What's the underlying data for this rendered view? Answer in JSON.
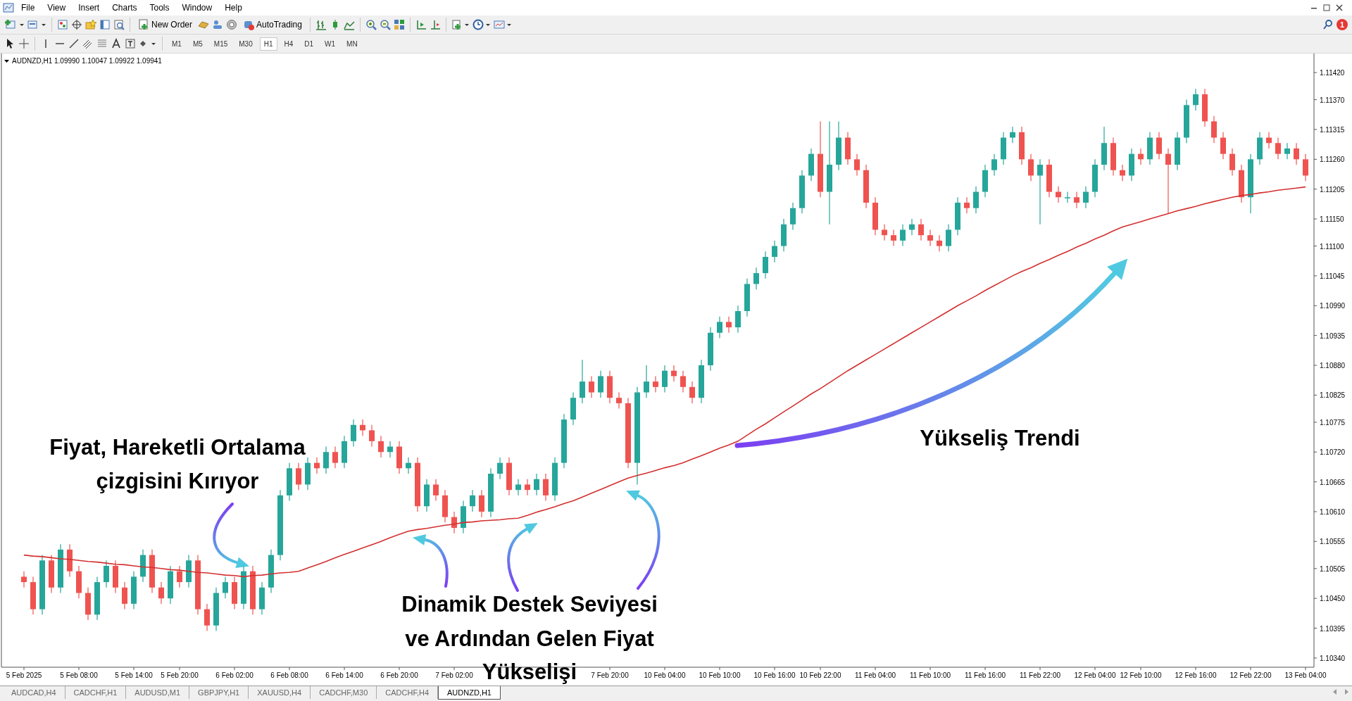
{
  "menu": [
    "File",
    "View",
    "Insert",
    "Charts",
    "Tools",
    "Window",
    "Help"
  ],
  "toolbar": {
    "buttons": [
      {
        "label": "New Order"
      },
      {
        "label": "AutoTrading"
      }
    ],
    "notification_count": "1"
  },
  "timeframes": [
    {
      "label": "M1",
      "selected": false
    },
    {
      "label": "M5",
      "selected": false
    },
    {
      "label": "M15",
      "selected": false
    },
    {
      "label": "M30",
      "selected": false
    },
    {
      "label": "H1",
      "selected": true
    },
    {
      "label": "H4",
      "selected": false
    },
    {
      "label": "D1",
      "selected": false
    },
    {
      "label": "W1",
      "selected": false
    },
    {
      "label": "MN",
      "selected": false
    }
  ],
  "chart": {
    "symbol_info": "AUDNZD,H1  1.09990 1.10047 1.09922 1.09941",
    "chart_data": {
      "type": "candlestick",
      "ylim": [
        1.10323,
        1.1145
      ],
      "yticks": [
        {
          "value": 1.1142,
          "label": "1.11420"
        },
        {
          "value": 1.1137,
          "label": "1.11370"
        },
        {
          "value": 1.11315,
          "label": "1.11315"
        },
        {
          "value": 1.1126,
          "label": "1.11260"
        },
        {
          "value": 1.11205,
          "label": "1.11205"
        },
        {
          "value": 1.1115,
          "label": "1.11150"
        },
        {
          "value": 1.111,
          "label": "1.11100"
        },
        {
          "value": 1.11045,
          "label": "1.11045"
        },
        {
          "value": 1.1099,
          "label": "1.10990"
        },
        {
          "value": 1.10935,
          "label": "1.10935"
        },
        {
          "value": 1.1088,
          "label": "1.10880"
        },
        {
          "value": 1.10825,
          "label": "1.10825"
        },
        {
          "value": 1.10775,
          "label": "1.10775"
        },
        {
          "value": 1.1072,
          "label": "1.10720"
        },
        {
          "value": 1.10665,
          "label": "1.10665"
        },
        {
          "value": 1.1061,
          "label": "1.10610"
        },
        {
          "value": 1.10555,
          "label": "1.10555"
        },
        {
          "value": 1.10505,
          "label": "1.10505"
        },
        {
          "value": 1.1045,
          "label": "1.10450"
        },
        {
          "value": 1.10395,
          "label": "1.10395"
        },
        {
          "value": 1.1034,
          "label": "1.10340"
        }
      ],
      "categories": [
        "5 Feb 2025",
        null,
        null,
        null,
        null,
        null,
        "5 Feb 08:00",
        null,
        null,
        null,
        null,
        null,
        "5 Feb 14:00",
        null,
        null,
        null,
        null,
        "5 Feb 20:00",
        null,
        null,
        null,
        null,
        null,
        "6 Feb 02:00",
        null,
        null,
        null,
        null,
        null,
        "6 Feb 08:00",
        null,
        null,
        null,
        null,
        null,
        "6 Feb 14:00",
        null,
        null,
        null,
        null,
        null,
        "6 Feb 20:00",
        null,
        null,
        null,
        null,
        null,
        "7 Feb 02:00",
        null,
        null,
        null,
        null,
        null,
        null,
        null,
        null,
        null,
        null,
        null,
        null,
        null,
        null,
        null,
        null,
        "7 Feb 20:00",
        null,
        null,
        null,
        null,
        null,
        "10 Feb 04:00",
        null,
        null,
        null,
        null,
        null,
        "10 Feb 10:00",
        null,
        null,
        null,
        null,
        null,
        "10 Feb 16:00",
        null,
        null,
        null,
        null,
        "10 Feb 22:00",
        null,
        null,
        null,
        null,
        null,
        "11 Feb 04:00",
        null,
        null,
        null,
        null,
        null,
        "11 Feb 10:00",
        null,
        null,
        null,
        null,
        null,
        "11 Feb 16:00",
        null,
        null,
        null,
        null,
        null,
        "11 Feb 22:00",
        null,
        null,
        null,
        null,
        null,
        "12 Feb 04:00",
        null,
        null,
        null,
        null,
        "12 Feb 10:00",
        null,
        null,
        null,
        null,
        null,
        "12 Feb 16:00",
        null,
        null,
        null,
        null,
        null,
        "12 Feb 22:00",
        null,
        null,
        null,
        null,
        null,
        "13 Feb 04:00"
      ],
      "ohlc": [
        [
          1.1049,
          1.105,
          1.1047,
          1.1048
        ],
        [
          1.1048,
          1.1049,
          1.1042,
          1.1043
        ],
        [
          1.1043,
          1.1053,
          1.1042,
          1.1052
        ],
        [
          1.1052,
          1.1053,
          1.1046,
          1.1047
        ],
        [
          1.1047,
          1.1055,
          1.1046,
          1.1054
        ],
        [
          1.1054,
          1.1055,
          1.1049,
          1.105
        ],
        [
          1.105,
          1.1051,
          1.1045,
          1.1046
        ],
        [
          1.1046,
          1.1047,
          1.1041,
          1.1042
        ],
        [
          1.1042,
          1.1049,
          1.1041,
          1.1048
        ],
        [
          1.1048,
          1.1052,
          1.1047,
          1.1051
        ],
        [
          1.1051,
          1.1052,
          1.1046,
          1.1047
        ],
        [
          1.1047,
          1.1048,
          1.1043,
          1.1044
        ],
        [
          1.1044,
          1.105,
          1.1043,
          1.1049
        ],
        [
          1.1049,
          1.1054,
          1.1048,
          1.1053
        ],
        [
          1.1053,
          1.1054,
          1.1046,
          1.1047
        ],
        [
          1.1047,
          1.1048,
          1.1044,
          1.1045
        ],
        [
          1.1045,
          1.1051,
          1.1044,
          1.105
        ],
        [
          1.105,
          1.1051,
          1.1047,
          1.1048
        ],
        [
          1.1048,
          1.1053,
          1.1047,
          1.1052
        ],
        [
          1.1052,
          1.1053,
          1.1042,
          1.1043
        ],
        [
          1.1043,
          1.1044,
          1.1039,
          1.104
        ],
        [
          1.104,
          1.1047,
          1.1039,
          1.1046
        ],
        [
          1.1046,
          1.1049,
          1.1045,
          1.1048
        ],
        [
          1.1048,
          1.1049,
          1.1043,
          1.1044
        ],
        [
          1.1044,
          1.1051,
          1.1043,
          1.105
        ],
        [
          1.105,
          1.1051,
          1.1042,
          1.1043
        ],
        [
          1.1043,
          1.1048,
          1.1042,
          1.1047
        ],
        [
          1.1047,
          1.1054,
          1.1046,
          1.1053
        ],
        [
          1.1053,
          1.1065,
          1.1052,
          1.1064
        ],
        [
          1.1064,
          1.107,
          1.1063,
          1.1069
        ],
        [
          1.1069,
          1.107,
          1.1065,
          1.1066
        ],
        [
          1.1066,
          1.1071,
          1.1065,
          1.107
        ],
        [
          1.107,
          1.1071,
          1.1068,
          1.1069
        ],
        [
          1.1069,
          1.1073,
          1.1068,
          1.1072
        ],
        [
          1.1072,
          1.1073,
          1.1069,
          1.107
        ],
        [
          1.107,
          1.1075,
          1.1069,
          1.1074
        ],
        [
          1.1074,
          1.1078,
          1.1073,
          1.1077
        ],
        [
          1.1077,
          1.1078,
          1.1075,
          1.1076
        ],
        [
          1.1076,
          1.1077,
          1.1073,
          1.1074
        ],
        [
          1.1074,
          1.1075,
          1.1071,
          1.1072
        ],
        [
          1.1072,
          1.1074,
          1.1071,
          1.1073
        ],
        [
          1.1073,
          1.1074,
          1.1068,
          1.1069
        ],
        [
          1.1069,
          1.1071,
          1.1068,
          1.107
        ],
        [
          1.107,
          1.1071,
          1.1061,
          1.1062
        ],
        [
          1.1062,
          1.1067,
          1.1061,
          1.1066
        ],
        [
          1.1066,
          1.1067,
          1.1063,
          1.1064
        ],
        [
          1.1064,
          1.1065,
          1.1059,
          1.106
        ],
        [
          1.106,
          1.1061,
          1.1057,
          1.1058
        ],
        [
          1.1058,
          1.1063,
          1.1057,
          1.1062
        ],
        [
          1.1062,
          1.1065,
          1.1061,
          1.1064
        ],
        [
          1.1064,
          1.1065,
          1.106,
          1.1061
        ],
        [
          1.1061,
          1.1069,
          1.106,
          1.1068
        ],
        [
          1.1068,
          1.1071,
          1.1067,
          1.107
        ],
        [
          1.107,
          1.1071,
          1.1064,
          1.1065
        ],
        [
          1.1065,
          1.1067,
          1.1064,
          1.1066
        ],
        [
          1.1066,
          1.1067,
          1.1064,
          1.1065
        ],
        [
          1.1065,
          1.1068,
          1.1064,
          1.1067
        ],
        [
          1.1067,
          1.1068,
          1.1063,
          1.1064
        ],
        [
          1.1064,
          1.1071,
          1.1063,
          1.107
        ],
        [
          1.107,
          1.1079,
          1.1069,
          1.1078
        ],
        [
          1.1078,
          1.1083,
          1.1077,
          1.1082
        ],
        [
          1.1082,
          1.1089,
          1.1081,
          1.1085
        ],
        [
          1.1085,
          1.1086,
          1.1082,
          1.1083
        ],
        [
          1.1083,
          1.1087,
          1.1082,
          1.1086
        ],
        [
          1.1086,
          1.1087,
          1.1081,
          1.1082
        ],
        [
          1.1082,
          1.1083,
          1.108,
          1.1081
        ],
        [
          1.1081,
          1.1082,
          1.1069,
          1.107
        ],
        [
          1.107,
          1.1084,
          1.1066,
          1.1083
        ],
        [
          1.1083,
          1.1088,
          1.1082,
          1.1085
        ],
        [
          1.1085,
          1.1086,
          1.1083,
          1.1084
        ],
        [
          1.1084,
          1.1088,
          1.1083,
          1.1087
        ],
        [
          1.1087,
          1.1088,
          1.1085,
          1.1086
        ],
        [
          1.1086,
          1.1087,
          1.1083,
          1.1084
        ],
        [
          1.1084,
          1.1085,
          1.1081,
          1.1082
        ],
        [
          1.1082,
          1.1089,
          1.1081,
          1.1088
        ],
        [
          1.1088,
          1.1095,
          1.1087,
          1.1094
        ],
        [
          1.1094,
          1.1097,
          1.1093,
          1.1096
        ],
        [
          1.1096,
          1.1097,
          1.1094,
          1.1095
        ],
        [
          1.1095,
          1.1099,
          1.1094,
          1.1098
        ],
        [
          1.1098,
          1.1104,
          1.1097,
          1.1103
        ],
        [
          1.1103,
          1.1106,
          1.1102,
          1.1105
        ],
        [
          1.1105,
          1.1109,
          1.1104,
          1.1108
        ],
        [
          1.1108,
          1.1111,
          1.1107,
          1.111
        ],
        [
          1.111,
          1.1115,
          1.1109,
          1.1114
        ],
        [
          1.1114,
          1.1118,
          1.1113,
          1.1117
        ],
        [
          1.1117,
          1.1124,
          1.1116,
          1.1123
        ],
        [
          1.1123,
          1.1128,
          1.1122,
          1.1127
        ],
        [
          1.1127,
          1.1133,
          1.1119,
          1.112
        ],
        [
          1.112,
          1.1133,
          1.1114,
          1.1125
        ],
        [
          1.1125,
          1.1133,
          1.1124,
          1.113
        ],
        [
          1.113,
          1.1131,
          1.1125,
          1.1126
        ],
        [
          1.1126,
          1.1127,
          1.1123,
          1.1124
        ],
        [
          1.1124,
          1.1125,
          1.1117,
          1.1118
        ],
        [
          1.1118,
          1.1119,
          1.1112,
          1.1113
        ],
        [
          1.1113,
          1.1114,
          1.1111,
          1.1112
        ],
        [
          1.1112,
          1.1113,
          1.111,
          1.1111
        ],
        [
          1.1111,
          1.1114,
          1.111,
          1.1113
        ],
        [
          1.1113,
          1.1115,
          1.1112,
          1.1114
        ],
        [
          1.1114,
          1.1115,
          1.1111,
          1.1112
        ],
        [
          1.1112,
          1.1113,
          1.111,
          1.1111
        ],
        [
          1.1111,
          1.1112,
          1.1109,
          1.111
        ],
        [
          1.111,
          1.1114,
          1.1109,
          1.1113
        ],
        [
          1.1113,
          1.1119,
          1.1112,
          1.1118
        ],
        [
          1.1118,
          1.1119,
          1.1116,
          1.1117
        ],
        [
          1.1117,
          1.1121,
          1.1116,
          1.112
        ],
        [
          1.112,
          1.1125,
          1.1119,
          1.1124
        ],
        [
          1.1124,
          1.1127,
          1.1123,
          1.1126
        ],
        [
          1.1126,
          1.1131,
          1.1125,
          1.113
        ],
        [
          1.113,
          1.1132,
          1.1129,
          1.1131
        ],
        [
          1.1131,
          1.1132,
          1.1125,
          1.1126
        ],
        [
          1.1126,
          1.1127,
          1.1122,
          1.1123
        ],
        [
          1.1123,
          1.1126,
          1.1114,
          1.1125
        ],
        [
          1.1125,
          1.1126,
          1.1119,
          1.112
        ],
        [
          1.112,
          1.1121,
          1.1118,
          1.1119
        ],
        [
          1.1119,
          1.112,
          1.1118,
          1.1119
        ],
        [
          1.1119,
          1.112,
          1.1117,
          1.1118
        ],
        [
          1.1118,
          1.1121,
          1.1117,
          1.112
        ],
        [
          1.112,
          1.1126,
          1.1119,
          1.1125
        ],
        [
          1.1125,
          1.1132,
          1.1124,
          1.1129
        ],
        [
          1.1129,
          1.113,
          1.1123,
          1.1124
        ],
        [
          1.1124,
          1.1125,
          1.1122,
          1.1123
        ],
        [
          1.1123,
          1.1128,
          1.1122,
          1.1127
        ],
        [
          1.1127,
          1.1128,
          1.1125,
          1.1126
        ],
        [
          1.1126,
          1.1131,
          1.1125,
          1.113
        ],
        [
          1.113,
          1.1131,
          1.1126,
          1.1127
        ],
        [
          1.1127,
          1.1128,
          1.1116,
          1.1125
        ],
        [
          1.1125,
          1.1131,
          1.1124,
          1.113
        ],
        [
          1.113,
          1.1137,
          1.1129,
          1.1136
        ],
        [
          1.1136,
          1.1139,
          1.1135,
          1.1138
        ],
        [
          1.1138,
          1.1139,
          1.1132,
          1.1133
        ],
        [
          1.1133,
          1.1134,
          1.1129,
          1.113
        ],
        [
          1.113,
          1.1131,
          1.1126,
          1.1127
        ],
        [
          1.1127,
          1.1128,
          1.1123,
          1.1124
        ],
        [
          1.1124,
          1.1125,
          1.1118,
          1.1119
        ],
        [
          1.1119,
          1.1127,
          1.1116,
          1.1126
        ],
        [
          1.1126,
          1.1131,
          1.1125,
          1.113
        ],
        [
          1.113,
          1.1131,
          1.1128,
          1.1129
        ],
        [
          1.1129,
          1.113,
          1.1126,
          1.1127
        ],
        [
          1.1127,
          1.1129,
          1.1126,
          1.1128
        ],
        [
          1.1128,
          1.1129,
          1.1125,
          1.1126
        ],
        [
          1.1126,
          1.1127,
          1.1122,
          1.1123
        ]
      ],
      "series": [
        {
          "type": "line",
          "color": "#d32f2f",
          "values": [
            1.1053,
            1.10528,
            1.10527,
            1.10525,
            1.10523,
            1.10522,
            1.1052,
            1.10518,
            1.10517,
            1.10515,
            1.10513,
            1.10512,
            1.1051,
            1.10508,
            1.10507,
            1.10505,
            1.10503,
            1.10502,
            1.105,
            1.10498,
            1.10497,
            1.10495,
            1.10493,
            1.10492,
            1.1049,
            1.10492,
            1.10493,
            1.10495,
            1.10497,
            1.10498,
            1.105,
            1.10506,
            1.10512,
            1.10518,
            1.10525,
            1.10531,
            1.10537,
            1.10543,
            1.10549,
            1.10555,
            1.10562,
            1.10568,
            1.10574,
            1.10577,
            1.10579,
            1.10582,
            1.10585,
            1.10587,
            1.1059,
            1.10591,
            1.10593,
            1.10594,
            1.10595,
            1.10597,
            1.10598,
            1.10603,
            1.10609,
            1.10614,
            1.10619,
            1.10625,
            1.1063,
            1.10637,
            1.10644,
            1.10651,
            1.10658,
            1.10665,
            1.10672,
            1.10677,
            1.10681,
            1.10686,
            1.10691,
            1.10695,
            1.107,
            1.10707,
            1.10713,
            1.1072,
            1.10727,
            1.10733,
            1.1074,
            1.10751,
            1.10762,
            1.10772,
            1.10783,
            1.10794,
            1.10805,
            1.10816,
            1.10827,
            1.10837,
            1.10848,
            1.10859,
            1.1087,
            1.1088,
            1.1089,
            1.109,
            1.1091,
            1.1092,
            1.1093,
            1.1094,
            1.1095,
            1.1096,
            1.1097,
            1.1098,
            1.1099,
            1.10999,
            1.11008,
            1.11018,
            1.11027,
            1.11036,
            1.11045,
            1.11053,
            1.1106,
            1.11068,
            1.11075,
            1.11083,
            1.1109,
            1.11098,
            1.11105,
            1.11113,
            1.1112,
            1.11128,
            1.11135,
            1.1114,
            1.11145,
            1.1115,
            1.11155,
            1.1116,
            1.11165,
            1.11169,
            1.11173,
            1.11178,
            1.11182,
            1.11186,
            1.1119,
            1.11193,
            1.11195,
            1.11198,
            1.112,
            1.11203,
            1.11205,
            1.11207,
            1.11209
          ]
        }
      ],
      "annotations": [
        {
          "text": "Fiyat, Hareketli Ortalama\nçizgisini Kırıyor"
        },
        {
          "text": "Dinamik Destek Seviyesi\nve Ardından Gelen Fiyat\nYükselişi"
        },
        {
          "text": "Yükseliş Trendi"
        }
      ]
    }
  },
  "tabs": [
    {
      "label": "AUDCAD,H4",
      "selected": false
    },
    {
      "label": "CADCHF,H1",
      "selected": false
    },
    {
      "label": "AUDUSD,M1",
      "selected": false
    },
    {
      "label": "GBPJPY,H1",
      "selected": false
    },
    {
      "label": "XAUUSD,H4",
      "selected": false
    },
    {
      "label": "CADCHF,M30",
      "selected": false
    },
    {
      "label": "CADCHF,H4",
      "selected": false
    },
    {
      "label": "AUDNZD,H1",
      "selected": true
    }
  ]
}
